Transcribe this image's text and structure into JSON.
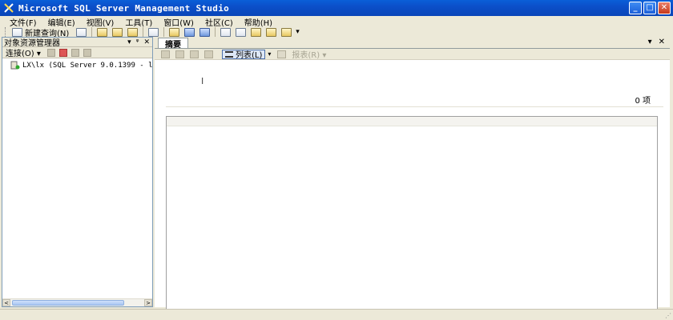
{
  "window": {
    "title": "Microsoft SQL Server Management Studio",
    "controls": {
      "minimize": "_",
      "maximize": "□",
      "close": "✕"
    }
  },
  "menu": [
    "文件(F)",
    "编辑(E)",
    "视图(V)",
    "工具(T)",
    "窗口(W)",
    "社区(C)",
    "帮助(H)"
  ],
  "toolbar": {
    "new_query_label": "新建查询(N)",
    "more": "▾"
  },
  "object_explorer": {
    "title": "对象资源管理器",
    "header_buttons": {
      "dropdown": "▾",
      "pin": "ᵠ",
      "close": "✕"
    },
    "connect_label": "连接(O) ▾",
    "tree_node": "LX\\lx (SQL Server 9.0.1399 - l",
    "scroll_left": "<",
    "scroll_right": ">"
  },
  "summary": {
    "tab_label": "摘要",
    "tab_buttons": {
      "dropdown": "▾",
      "close": "✕"
    },
    "list_button": "列表(L)",
    "list_dropdown": "▾",
    "report_button": "报表(R) ▾",
    "item_count": "0 项",
    "cursor_glyph": "I"
  },
  "colors": {
    "titlebar": "#0a5fd8",
    "chrome": "#ece9d8",
    "pane_border": "#7f9db9"
  }
}
